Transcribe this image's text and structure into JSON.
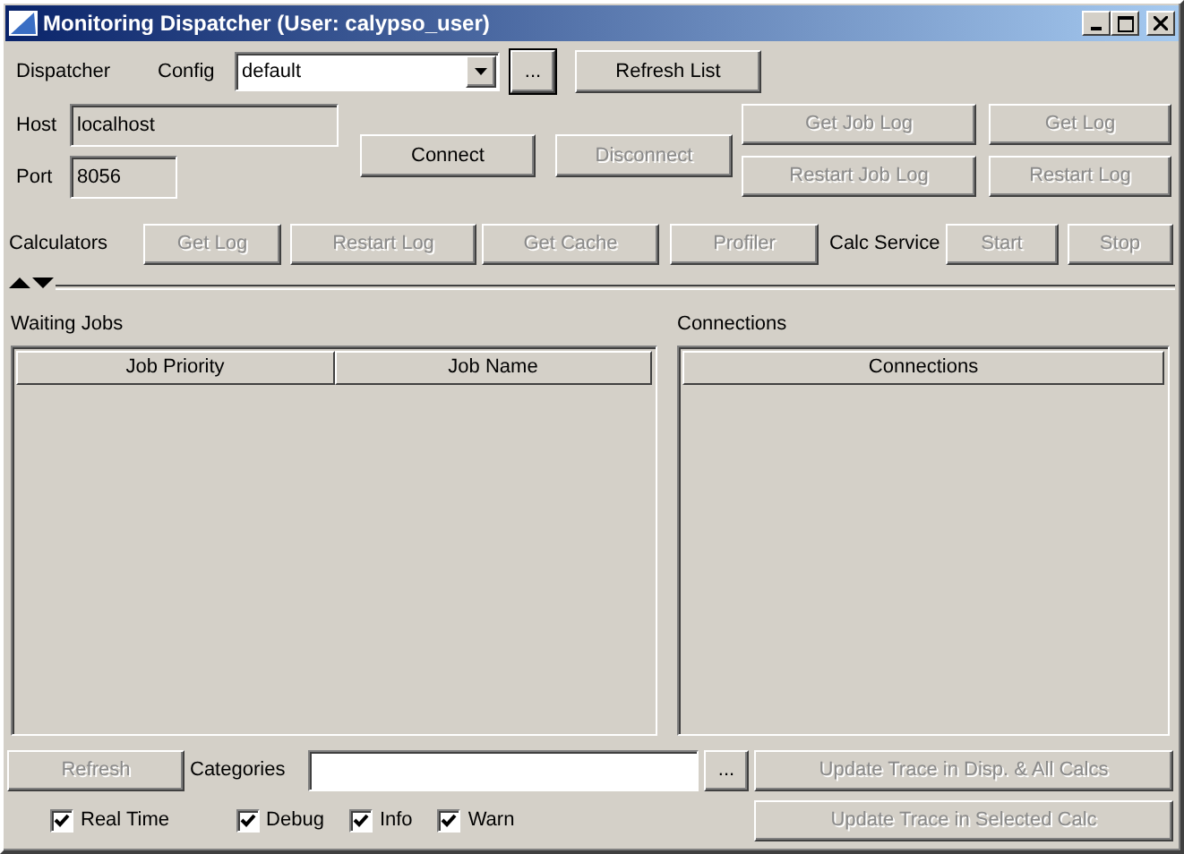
{
  "window": {
    "title": "Monitoring Dispatcher (User: calypso_user)"
  },
  "dispatcher": {
    "label": "Dispatcher",
    "config_label": "Config",
    "config_value": "default",
    "browse_button": {
      "label": "...",
      "disabled": false
    },
    "refresh_list_button": {
      "label": "Refresh List",
      "disabled": false
    },
    "host_label": "Host",
    "host_value": "localhost",
    "port_label": "Port",
    "port_value": "8056",
    "connect_button": {
      "label": "Connect",
      "disabled": false
    },
    "disconnect_button": {
      "label": "Disconnect",
      "disabled": true
    },
    "log_buttons": [
      {
        "label": "Get Job Log",
        "disabled": true
      },
      {
        "label": "Get Log",
        "disabled": true
      },
      {
        "label": "Restart Job Log",
        "disabled": true
      },
      {
        "label": "Restart Log",
        "disabled": true
      }
    ]
  },
  "calculators": {
    "label": "Calculators",
    "buttons": [
      {
        "label": "Get Log",
        "disabled": true
      },
      {
        "label": "Restart Log",
        "disabled": true
      },
      {
        "label": "Get Cache",
        "disabled": true
      },
      {
        "label": "Profiler",
        "disabled": true
      }
    ],
    "calc_service_label": "Calc Service",
    "service_buttons": [
      {
        "label": "Start",
        "disabled": true
      },
      {
        "label": "Stop",
        "disabled": true
      }
    ]
  },
  "waiting_jobs": {
    "label": "Waiting Jobs",
    "columns": [
      "Job Priority",
      "Job Name"
    ]
  },
  "connections": {
    "label": "Connections",
    "columns": [
      "Connections"
    ]
  },
  "trace": {
    "refresh_button": {
      "label": "Refresh",
      "disabled": true
    },
    "categories_label": "Categories",
    "categories_browse": {
      "label": "...",
      "disabled": false
    },
    "update_all_button": {
      "label": "Update Trace in Disp. & All Calcs",
      "disabled": true
    },
    "update_selected_button": {
      "label": "Update Trace in Selected Calc",
      "disabled": true
    },
    "checkboxes": [
      {
        "label": "Real Time",
        "checked": true
      },
      {
        "label": "Debug",
        "checked": true
      },
      {
        "label": "Info",
        "checked": true
      },
      {
        "label": "Warn",
        "checked": true
      }
    ]
  }
}
